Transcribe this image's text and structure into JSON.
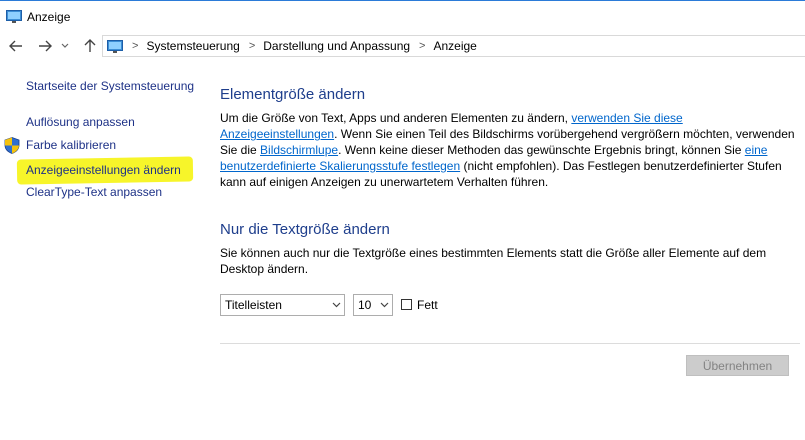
{
  "window": {
    "title": "Anzeige"
  },
  "navigation": {
    "breadcrumbs": [
      "Systemsteuerung",
      "Darstellung und Anpassung",
      "Anzeige"
    ]
  },
  "sidebar": {
    "home": "Startseite der Systemsteuerung",
    "items": [
      {
        "label": "Auflösung anpassen"
      },
      {
        "label": "Farbe kalibrieren",
        "icon": "shield-icon"
      },
      {
        "label": "Anzeigeeinstellungen ändern",
        "highlighted": true
      },
      {
        "label": "ClearType-Text anpassen"
      }
    ]
  },
  "main": {
    "section1": {
      "heading": "Elementgröße ändern",
      "text_a": "Um die Größe von Text, Apps und anderen Elementen zu ändern, ",
      "link_a": "verwenden Sie diese Anzeigeeinstellungen",
      "text_b": ". Wenn Sie einen Teil des Bildschirms vorübergehend vergrößern möchten, verwenden Sie die ",
      "link_b": "Bildschirmlupe",
      "text_c": ". Wenn keine dieser Methoden das gewünschte Ergebnis bringt, können Sie ",
      "link_c": "eine benutzerdefinierte Skalierungsstufe festlegen",
      "text_d": " (nicht empfohlen). Das Festlegen benutzerdefinierter Stufen kann auf einigen Anzeigen zu unerwartetem Verhalten führen."
    },
    "section2": {
      "heading": "Nur die Textgröße ändern",
      "text": "Sie können auch nur die Textgröße eines bestimmten Elements statt die Größe aller Elemente auf dem Desktop ändern.",
      "element_select": "Titelleisten",
      "size_select": "10",
      "bold_label": "Fett"
    },
    "apply_button": "Übernehmen"
  },
  "colors": {
    "heading": "#1e3e8c",
    "link": "#0066cc",
    "sidebar_link": "#1e3287",
    "highlight": "#f7f52a"
  }
}
